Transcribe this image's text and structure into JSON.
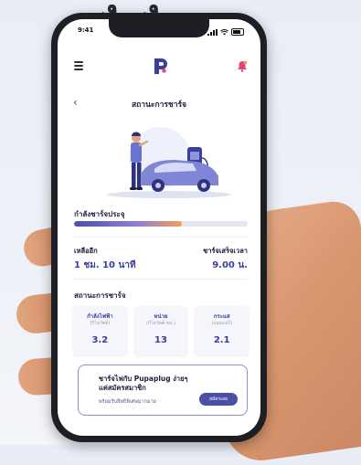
{
  "status_bar": {
    "time": "9:41"
  },
  "header": {
    "logo_letter": "P"
  },
  "title_bar": {
    "back_glyph": "‹",
    "title": "สถานะการชาร์จ"
  },
  "progress": {
    "label": "กำลังชาร์จประจุ",
    "value": 0.62
  },
  "remaining": {
    "label": "เหลืออีก",
    "value": "1 ชม. 10 นาที"
  },
  "finish": {
    "label": "ชาร์จเสร็จเวลา",
    "value": "9.00 น."
  },
  "status_section": {
    "title": "สถานะการชาร์จ"
  },
  "stats": [
    {
      "label": "กำลังไฟฟ้า",
      "unit": "(กิโลวัตต์)",
      "value": "3.2"
    },
    {
      "label": "หน่วย",
      "unit": "(กิโลวัตต์-ชม.)",
      "value": "13"
    },
    {
      "label": "กระแส",
      "unit": "(แอมแปร์)",
      "value": "2.1"
    }
  ],
  "promo": {
    "line1": "ชาร์จไฟกับ Pupaplug ง่ายๆ",
    "line2": "แค่สมัครสมาชิก",
    "subtitle": "พร้อมรับสิทธิพิเศษมากมาย",
    "button_label": "สมัครเลย"
  },
  "colors": {
    "accent": "#3a3f9c",
    "progress_end": "#f2a15b",
    "logo_pink": "#e2457a"
  },
  "icons": [
    "menu-icon",
    "bell-icon",
    "back-icon",
    "signal-icon",
    "wifi-icon",
    "battery-icon"
  ]
}
